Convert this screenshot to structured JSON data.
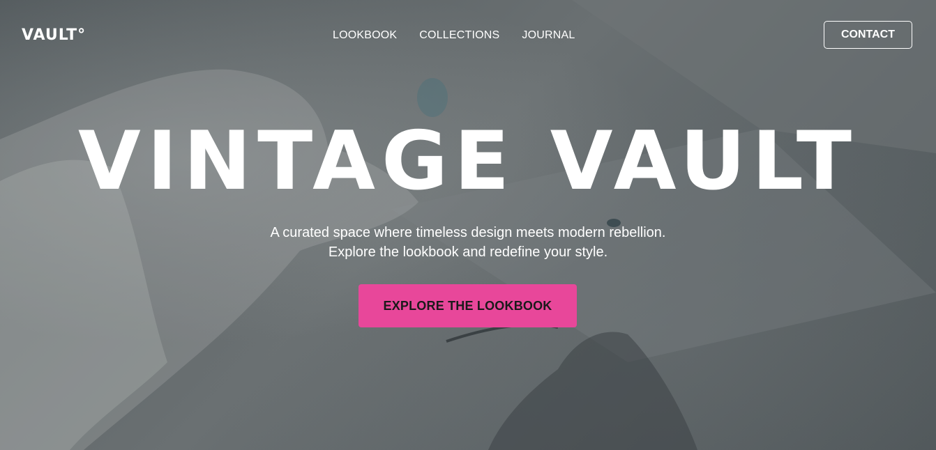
{
  "header": {
    "logo": "VAULT°",
    "nav": [
      {
        "label": "LOOKBOOK"
      },
      {
        "label": "COLLECTIONS"
      },
      {
        "label": "JOURNAL"
      }
    ],
    "contact_label": "CONTACT"
  },
  "hero": {
    "title": "VINTAGE VAULT",
    "subtitle_line1": "A curated space where timeless design meets modern rebellion.",
    "subtitle_line2": "Explore the lookbook and redefine your style.",
    "cta_label": "EXPLORE THE LOOKBOOK",
    "cta_color": "#e8479a",
    "background_image": "gloved-hands-holding-glass-slide"
  }
}
